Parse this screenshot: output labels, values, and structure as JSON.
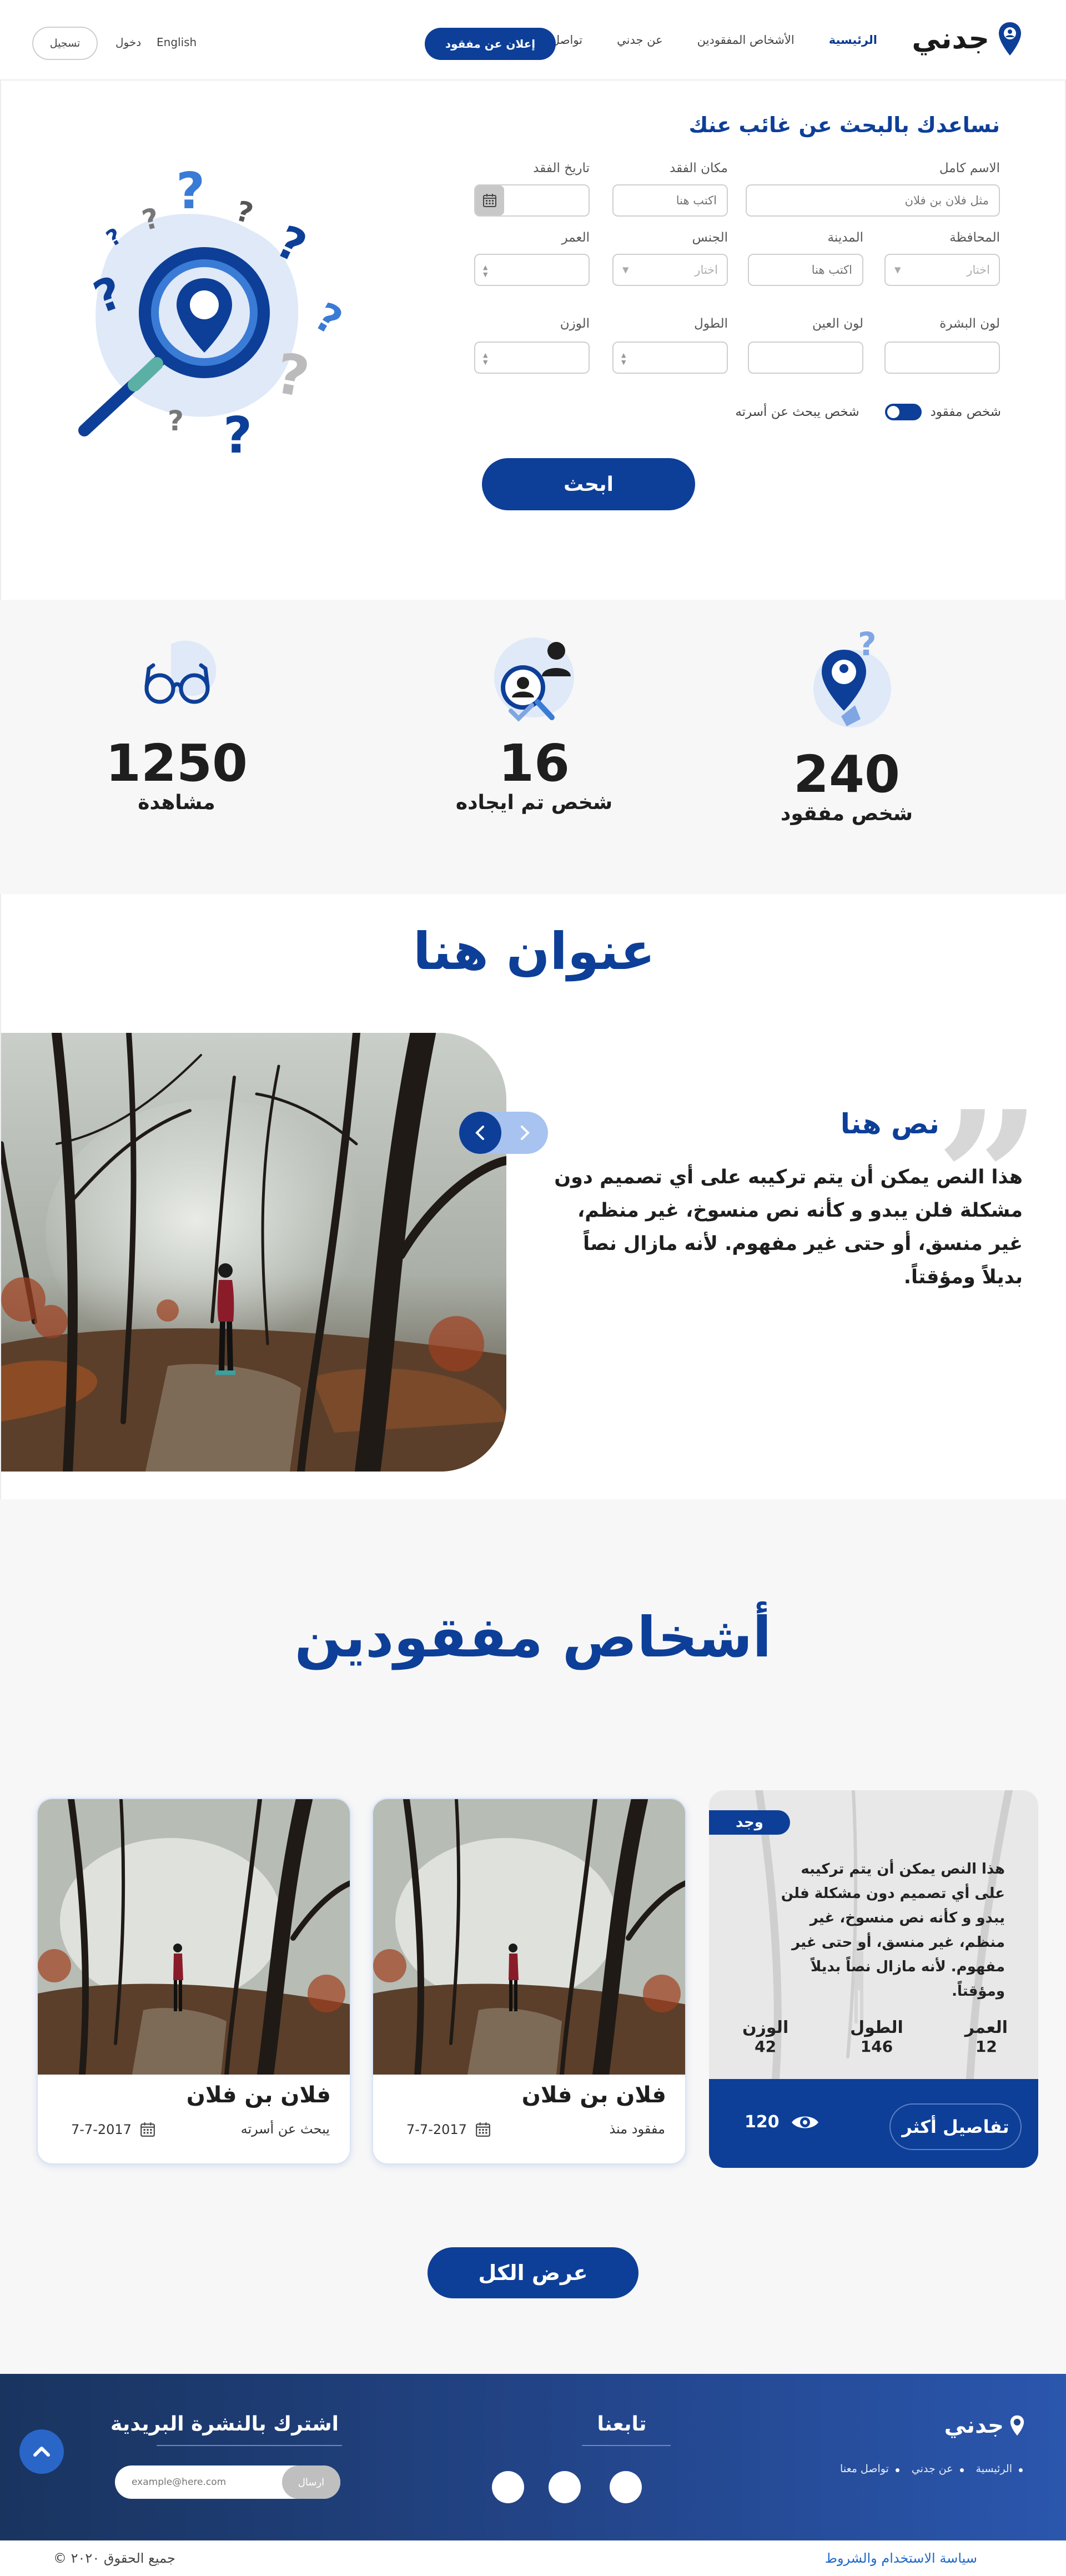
{
  "header": {
    "logo_text": "جدني",
    "nav": [
      "الرئيسية",
      "الأشخاص المفقودين",
      "عن جدني",
      "تواصل بنا"
    ],
    "report_button": "إعلان عن مفقود",
    "language": "English",
    "login": "دخول",
    "register": "تسجيل"
  },
  "search": {
    "title": "نساعدك بالبحث عن غائب عنك",
    "fields": {
      "full_name": {
        "label": "الاسم كامل",
        "placeholder": "مثل فلان بن فلان"
      },
      "lost_place": {
        "label": "مكان الفقد",
        "placeholder": "اكتب هنا"
      },
      "lost_date": {
        "label": "تاريخ الفقد"
      },
      "governorate": {
        "label": "المحافظة",
        "placeholder": "اختار"
      },
      "city": {
        "label": "المدينة",
        "placeholder": "اكتب هنا"
      },
      "gender": {
        "label": "الجنس",
        "placeholder": "اختار"
      },
      "age": {
        "label": "العمر"
      },
      "skin_color": {
        "label": "لون البشرة"
      },
      "eye_color": {
        "label": "لون العين"
      },
      "height": {
        "label": "الطول"
      },
      "weight": {
        "label": "الوزن"
      }
    },
    "toggle_left": "شخص مفقود",
    "toggle_right": "شخص يبحث عن أسرته",
    "button": "ابحث"
  },
  "stats": [
    {
      "number": "240",
      "label": "شخص مفقود",
      "icon": "missing-pin-icon"
    },
    {
      "number": "16",
      "label": "شخص  تم ايجاده",
      "icon": "found-person-icon"
    },
    {
      "number": "1250",
      "label": "مشاهدة",
      "icon": "glasses-icon"
    }
  ],
  "feature": {
    "title": "عنوان هنا",
    "quote_title": "نص هنا",
    "quote_body": "هذا النص يمكن أن يتم تركيبه على أي تصميم دون مشكلة فلن يبدو و كأنه نص منسوخ، غير منظم، غير منسق، أو حتى غير مفهوم. لأنه مازال نصاً بديلاً ومؤقتاً."
  },
  "missing": {
    "title": "أشخاص مفقودين",
    "highlight": {
      "badge": "وجد",
      "text": "هذا النص يمكن أن يتم تركيبه على أي تصميم دون مشكلة فلن يبدو و كأنه نص منسوخ، غير منظم، غير منسق، أو حتى غير مفهوم. لأنه مازال نصاً بديلاً ومؤقتاً.",
      "age_label": "العمر",
      "age": "12",
      "height_label": "الطول",
      "height": "146",
      "weight_label": "الوزن",
      "weight": "42",
      "details_button": "تفاصيل أكثر",
      "views": "120"
    },
    "cards": [
      {
        "name": "فلان بن فلان",
        "status": "مفقود منذ",
        "date": "7-7-2017"
      },
      {
        "name": "فلان بن فلان",
        "status": "يبحث عن أسرته",
        "date": "7-7-2017"
      }
    ],
    "view_all": "عرض الكل"
  },
  "footer": {
    "logo_text": "جدني",
    "links": [
      "الرئيسية",
      "عن جدني",
      "تواصل معنا"
    ],
    "follow_title": "تابعنا",
    "newsletter_title": "اشترك بالنشرة البريدية",
    "newsletter_placeholder": "example@here.com",
    "newsletter_button": "ارسال",
    "terms": "سياسة الاستخدام والشروط",
    "rights": "جميع الحقوق ٢٠٢٠ ©"
  },
  "colors": {
    "primary": "#0d3f98",
    "accent": "#2a66c8",
    "light_blue": "#a8c3f0"
  }
}
